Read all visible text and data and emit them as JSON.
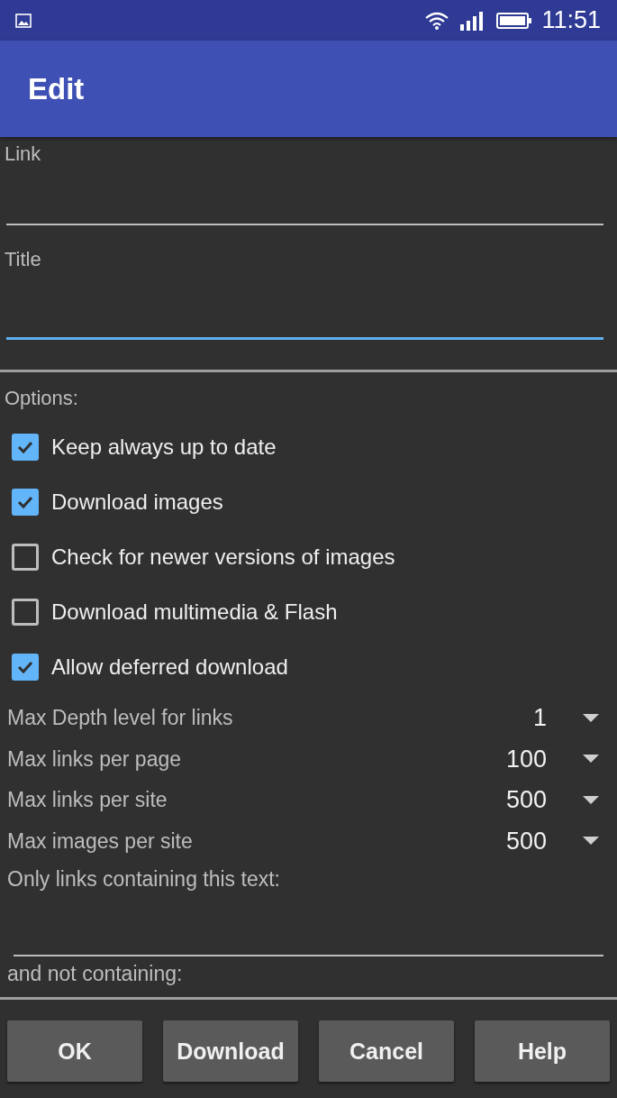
{
  "status_bar": {
    "time": "11:51"
  },
  "app_bar": {
    "title": "Edit"
  },
  "fields": [
    {
      "label": "Link",
      "focused": false
    },
    {
      "label": "Title",
      "focused": true
    }
  ],
  "options": {
    "heading": "Options:",
    "checkboxes": [
      {
        "label": "Keep always up to date",
        "checked": true
      },
      {
        "label": "Download images",
        "checked": true
      },
      {
        "label": "Check for newer versions of images",
        "checked": false
      },
      {
        "label": "Download multimedia & Flash",
        "checked": false
      },
      {
        "label": "Allow deferred download",
        "checked": true
      }
    ],
    "dropdowns": [
      {
        "label": "Max Depth level for links",
        "value": "1"
      },
      {
        "label": "Max links per page",
        "value": "100"
      },
      {
        "label": "Max links per site",
        "value": "500"
      },
      {
        "label": "Max images per site",
        "value": "500"
      }
    ],
    "containing": {
      "label": "Only links containing this text:"
    },
    "not_containing": {
      "label": "and not containing:"
    }
  },
  "buttons": [
    "OK",
    "Download",
    "Cancel",
    "Help"
  ]
}
